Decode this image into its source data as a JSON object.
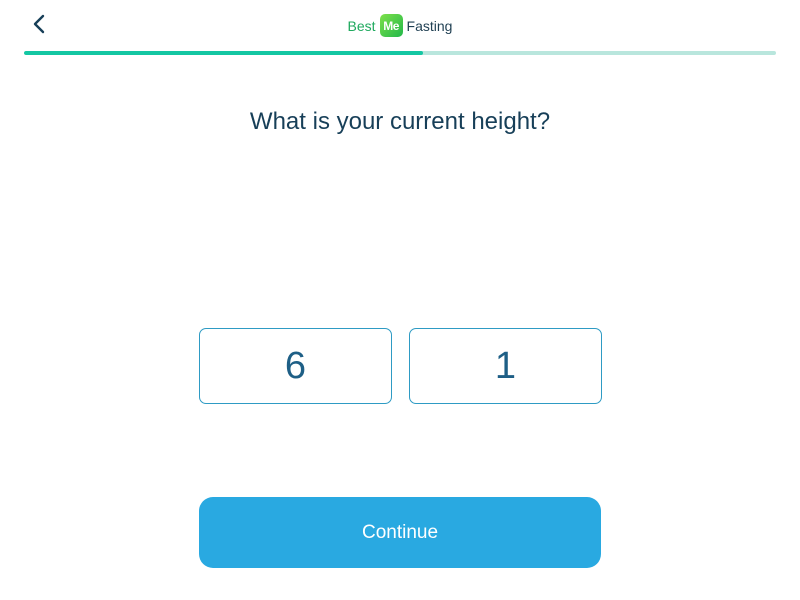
{
  "header": {
    "back_icon": "chevron-left-icon",
    "logo": {
      "left_text": "Best",
      "badge_text": "Me",
      "right_text": "Fasting"
    }
  },
  "progress": {
    "fraction": 0.53
  },
  "question": {
    "text": "What is your current height?"
  },
  "height": {
    "feet_value": "6",
    "inches_value": "1"
  },
  "actions": {
    "continue_label": "Continue"
  },
  "colors": {
    "accent": "#29a9e1",
    "progress_fill": "#14c7a3",
    "progress_track": "#b9e6dd",
    "text_dark": "#173f58",
    "brand_green": "#1fa95e"
  }
}
